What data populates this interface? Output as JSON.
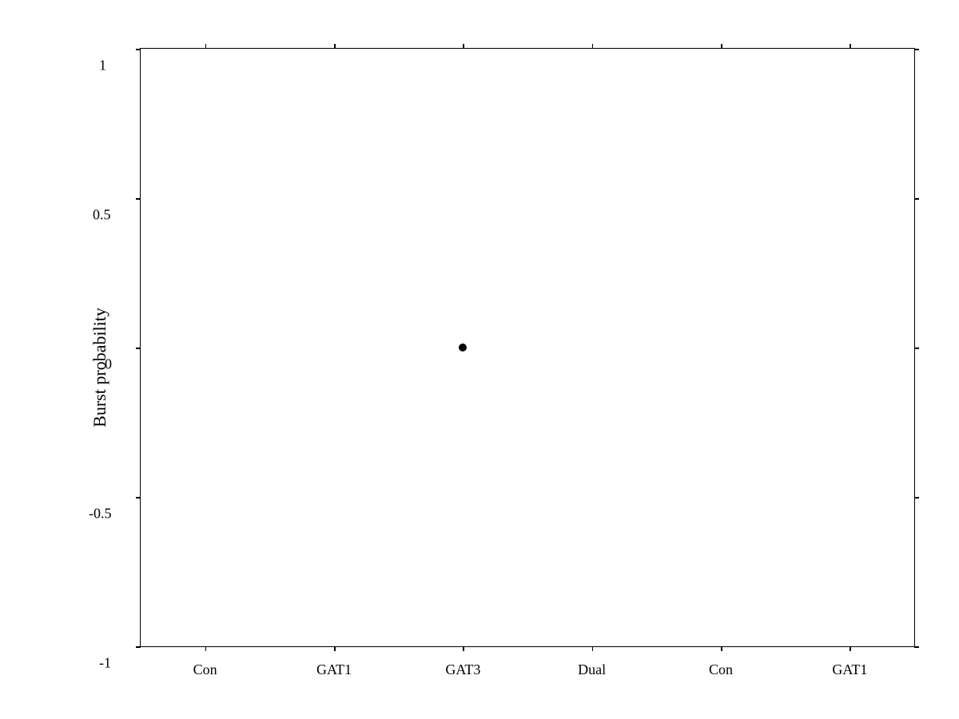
{
  "chart": {
    "title": "",
    "y_axis": {
      "label": "Burst probability",
      "min": -1,
      "max": 1,
      "ticks": [
        "-1",
        "-0.5",
        "0",
        "0.5",
        "1"
      ]
    },
    "x_axis": {
      "labels": [
        "Con",
        "GAT1",
        "GAT3",
        "Dual",
        "Con",
        "GAT1"
      ]
    },
    "data_points": [
      {
        "x_label": "GAT3",
        "x_index": 2,
        "y_value": 0.0
      }
    ]
  }
}
